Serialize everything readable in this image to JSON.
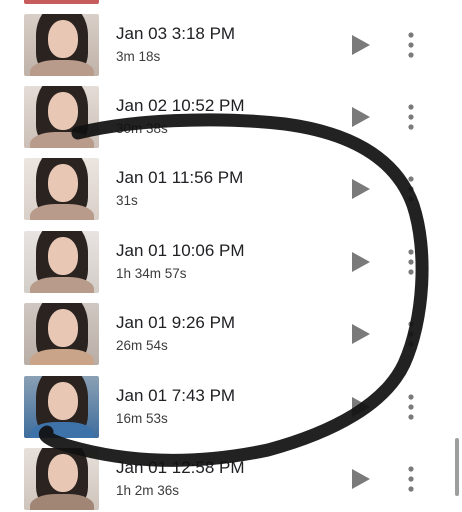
{
  "recordings": [
    {
      "title": "Jan 03 3:18 PM",
      "duration": "3m 18s"
    },
    {
      "title": "Jan 02 10:52 PM",
      "duration": "30m 38s"
    },
    {
      "title": "Jan 01 11:56 PM",
      "duration": "31s"
    },
    {
      "title": "Jan 01 10:06 PM",
      "duration": "1h 34m 57s"
    },
    {
      "title": "Jan 01 9:26 PM",
      "duration": "26m 54s"
    },
    {
      "title": "Jan 01 7:43 PM",
      "duration": "16m 53s"
    },
    {
      "title": "Jan 01 12:58 PM",
      "duration": "1h 2m 36s"
    }
  ],
  "icons": {
    "play": "play-icon",
    "more": "more-vert-icon"
  },
  "colors": {
    "text": "#202124",
    "icon": "#7a7a7a",
    "scribble": "#111111"
  }
}
